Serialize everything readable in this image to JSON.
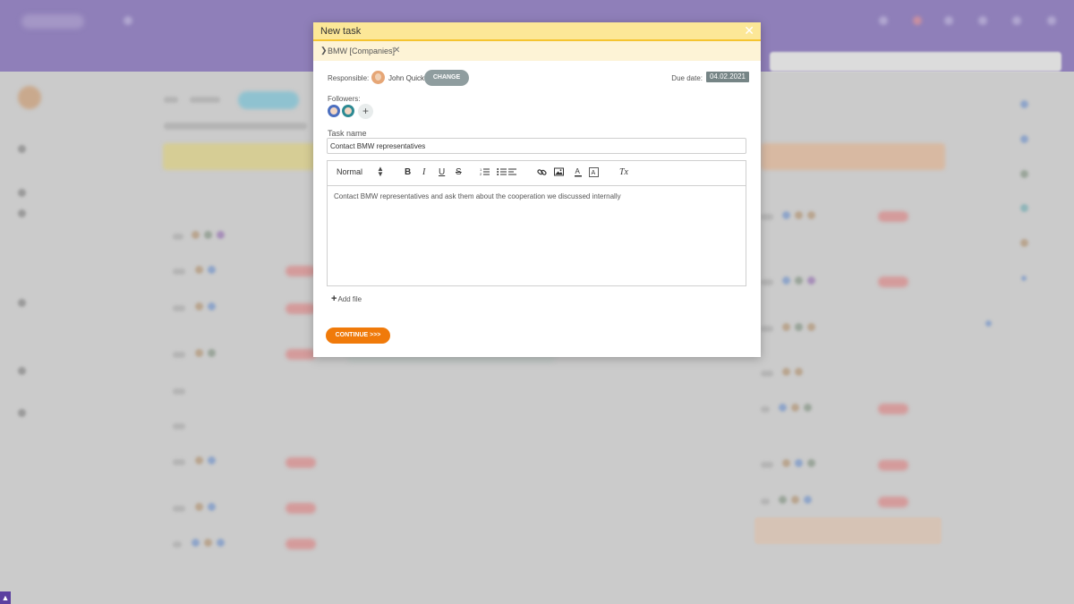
{
  "modal": {
    "title": "New task",
    "close_icon": "close-icon",
    "breadcrumb": {
      "text": "BMW [Companies]",
      "remove_icon": "close-icon"
    },
    "responsible": {
      "label": "Responsible:",
      "name": "John Quick",
      "change_label": "CHANGE"
    },
    "due_date": {
      "label": "Due date:",
      "value": "04.02.2021"
    },
    "followers": {
      "label": "Followers:",
      "add_label": "+"
    },
    "task_name": {
      "label": "Task name",
      "value": "Contact BMW representatives"
    },
    "editor": {
      "format_select": "Normal",
      "toolbar": {
        "bold": "B",
        "italic": "I",
        "underline": "U",
        "strike": "S",
        "clear_format": "Tx"
      },
      "body": "Contact BMW representatives and ask them about the cooperation we discussed internally"
    },
    "add_file_label": "Add file",
    "continue_label": "CONTINUE >>>"
  },
  "colors": {
    "header_bg": "#fce797",
    "header_border": "#f5c430",
    "breadcrumb_bg": "#fdf3d6",
    "change_button": "#8f9d9f",
    "due_badge": "#768586",
    "continue_button": "#f07a0a",
    "topbar_bg": "#8f7fb9"
  }
}
